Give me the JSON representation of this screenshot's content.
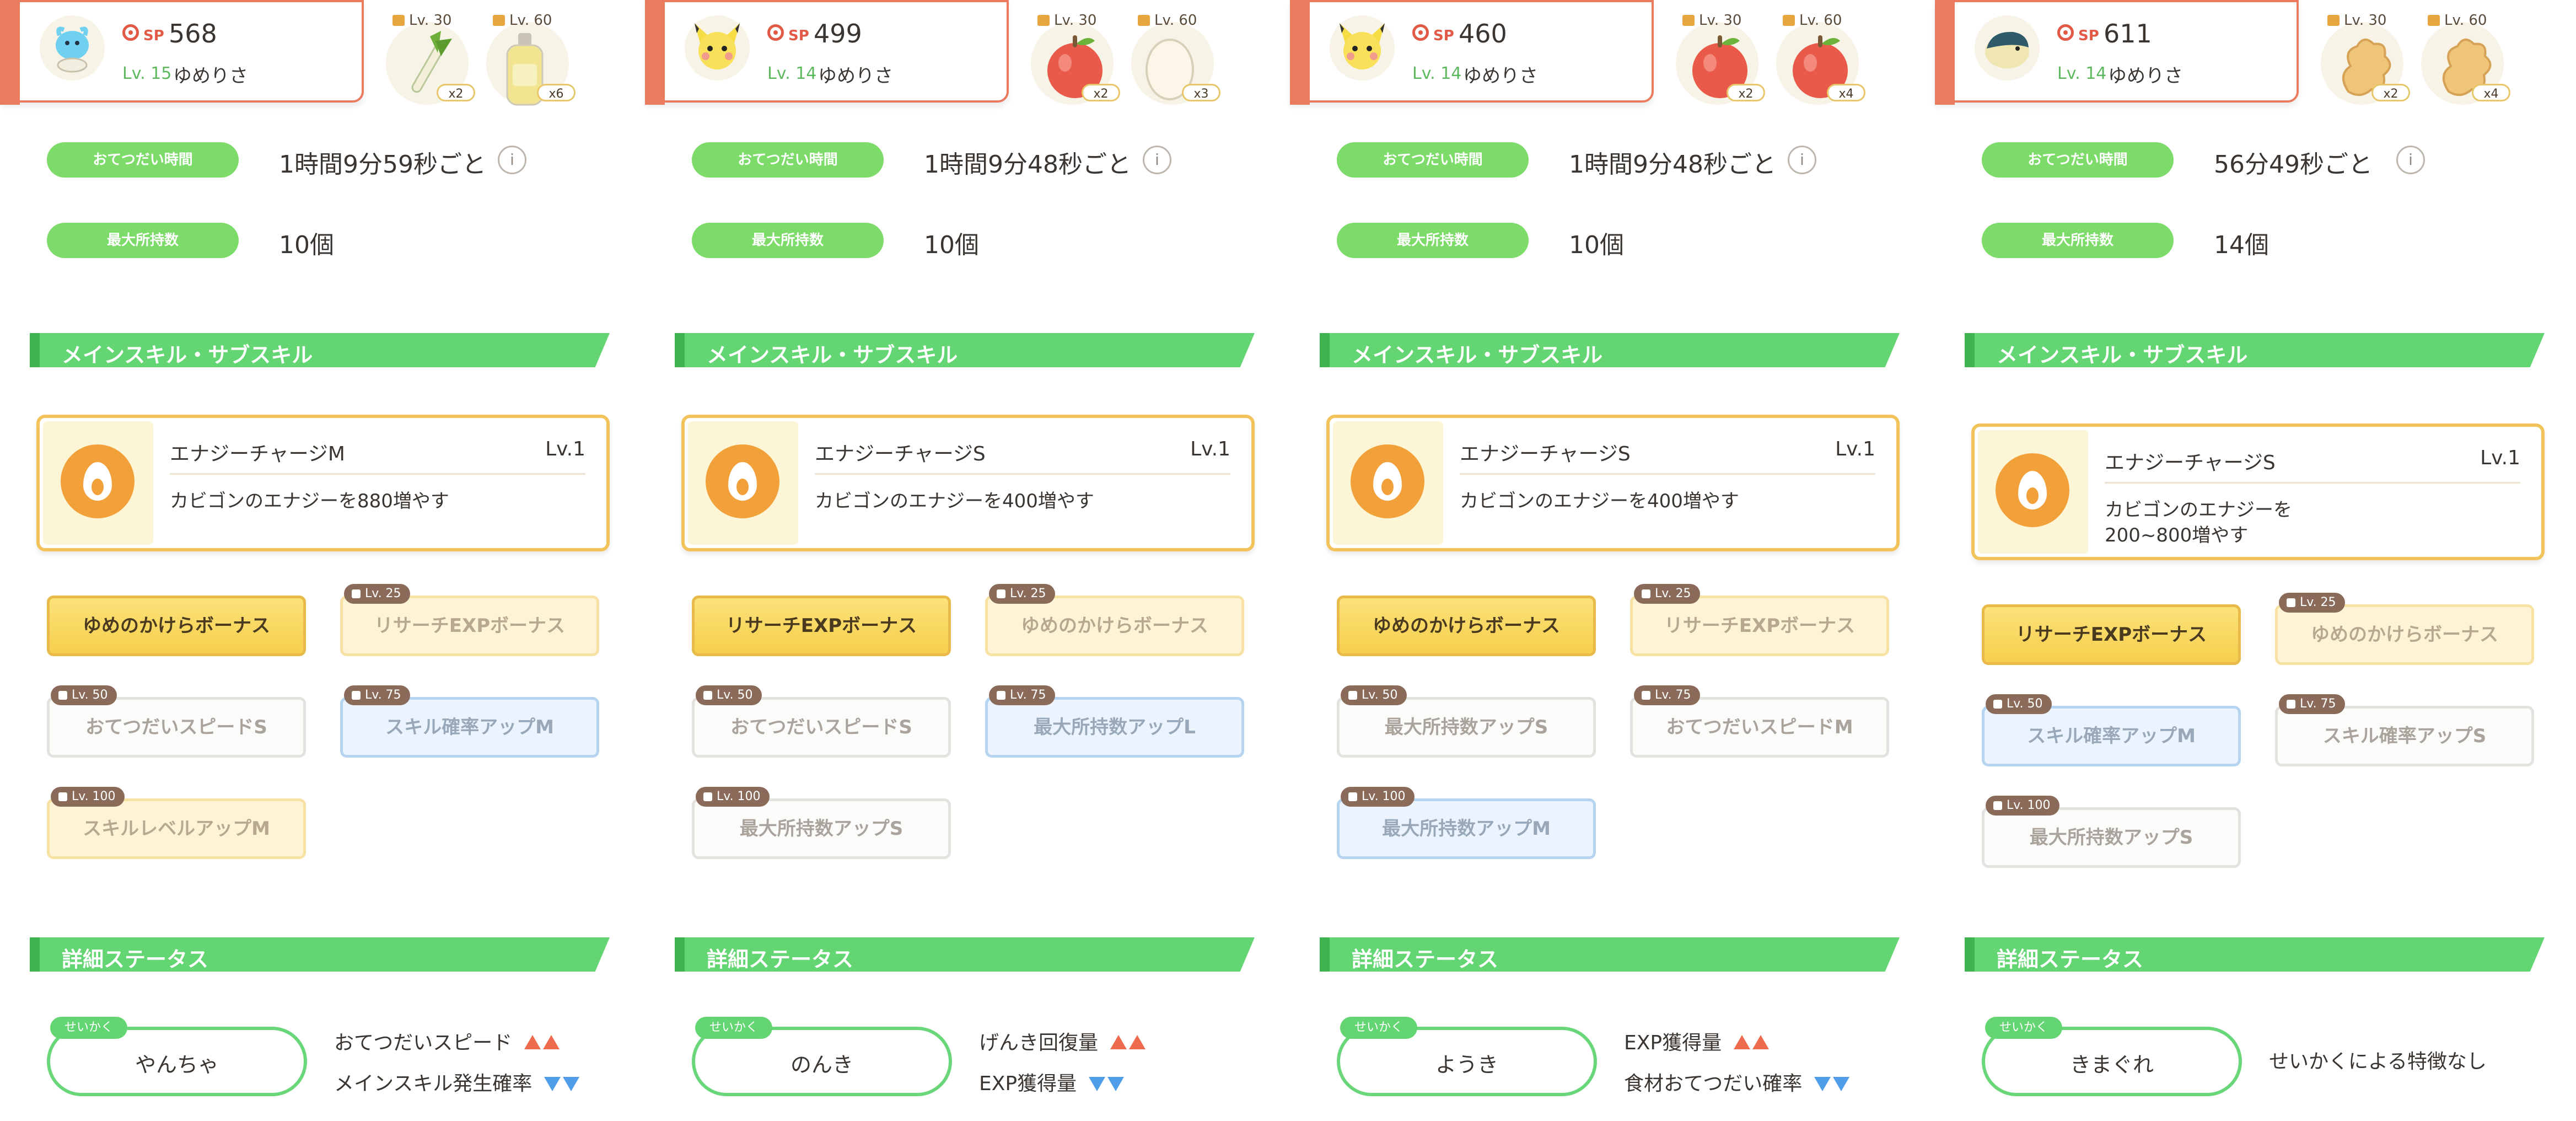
{
  "ui": {
    "sp_label": "SP",
    "work_label": "おてつだい時間",
    "cap_label": "最大所持数",
    "skill_header": "メインスキル・サブスキル",
    "detail_header": "詳細ステータス",
    "nature_tag": "せいかく"
  },
  "colors": {
    "accent_header": "#ea7b5f",
    "green": "#64d573",
    "pill_green": "#7ddb6a",
    "skill_border": "#f2c35a",
    "gold": "#f8d860",
    "up_arrow": "#ee6c4d",
    "down_arrow": "#4f9de8"
  },
  "cards": [
    {
      "sp": "568",
      "level": "Lv. 15",
      "nickname": "ゆめりさ",
      "pokemon_icon": "quagsire-like-icon",
      "ingredients": [
        {
          "level": "Lv. 30",
          "qty": "x2",
          "icon": "leek-icon"
        },
        {
          "level": "Lv. 60",
          "qty": "x6",
          "icon": "oil-bottle-icon"
        }
      ],
      "work_time": "1時間9分59秒ごと",
      "capacity": "10個",
      "main_skill": {
        "name": "エナジーチャージM",
        "level": "Lv.1",
        "desc": "カビゴンのエナジーを880増やす"
      },
      "sub_skills": [
        {
          "name": "ゆめのかけらボーナス",
          "unlock": ""
        },
        {
          "name": "リサーチEXPボーナス",
          "unlock": "Lv. 25"
        },
        {
          "name": "おてつだいスピードS",
          "unlock": "Lv. 50"
        },
        {
          "name": "スキル確率アップM",
          "unlock": "Lv. 75"
        },
        {
          "name": "スキルレベルアップM",
          "unlock": "Lv. 100"
        }
      ],
      "nature": "やんちゃ",
      "effects": [
        {
          "text": "おてつだいスピード",
          "dir": "up"
        },
        {
          "text": "メインスキル発生確率",
          "dir": "down"
        }
      ]
    },
    {
      "sp": "499",
      "level": "Lv. 14",
      "nickname": "ゆめりさ",
      "pokemon_icon": "pichu-icon",
      "ingredients": [
        {
          "level": "Lv. 30",
          "qty": "x2",
          "icon": "apple-icon"
        },
        {
          "level": "Lv. 60",
          "qty": "x3",
          "icon": "egg-icon"
        }
      ],
      "work_time": "1時間9分48秒ごと",
      "capacity": "10個",
      "main_skill": {
        "name": "エナジーチャージS",
        "level": "Lv.1",
        "desc": "カビゴンのエナジーを400増やす"
      },
      "sub_skills": [
        {
          "name": "リサーチEXPボーナス",
          "unlock": ""
        },
        {
          "name": "ゆめのかけらボーナス",
          "unlock": "Lv. 25"
        },
        {
          "name": "おてつだいスピードS",
          "unlock": "Lv. 50"
        },
        {
          "name": "最大所持数アップL",
          "unlock": "Lv. 75"
        },
        {
          "name": "最大所持数アップS",
          "unlock": "Lv. 100"
        }
      ],
      "nature": "のんき",
      "effects": [
        {
          "text": "げんき回復量",
          "dir": "up"
        },
        {
          "text": "EXP獲得量",
          "dir": "down"
        }
      ]
    },
    {
      "sp": "460",
      "level": "Lv. 14",
      "nickname": "ゆめりさ",
      "pokemon_icon": "pichu-icon",
      "ingredients": [
        {
          "level": "Lv. 30",
          "qty": "x2",
          "icon": "apple-icon"
        },
        {
          "level": "Lv. 60",
          "qty": "x4",
          "icon": "apple-icon"
        }
      ],
      "work_time": "1時間9分48秒ごと",
      "capacity": "10個",
      "main_skill": {
        "name": "エナジーチャージS",
        "level": "Lv.1",
        "desc": "カビゴンのエナジーを400増やす"
      },
      "sub_skills": [
        {
          "name": "ゆめのかけらボーナス",
          "unlock": ""
        },
        {
          "name": "リサーチEXPボーナス",
          "unlock": "Lv. 25"
        },
        {
          "name": "最大所持数アップS",
          "unlock": "Lv. 50"
        },
        {
          "name": "おてつだいスピードM",
          "unlock": "Lv. 75"
        },
        {
          "name": "最大所持数アップM",
          "unlock": "Lv. 100"
        }
      ],
      "nature": "ようき",
      "effects": [
        {
          "text": "EXP獲得量",
          "dir": "up"
        },
        {
          "text": "食材おてつだい確率",
          "dir": "down"
        }
      ]
    },
    {
      "sp": "611",
      "level": "Lv. 14",
      "nickname": "ゆめりさ",
      "pokemon_icon": "cyndaquil-icon",
      "ingredients": [
        {
          "level": "Lv. 30",
          "qty": "x2",
          "icon": "ginger-icon"
        },
        {
          "level": "Lv. 60",
          "qty": "x4",
          "icon": "ginger-icon"
        }
      ],
      "work_time": "56分49秒ごと",
      "capacity": "14個",
      "main_skill": {
        "name": "エナジーチャージS",
        "level": "Lv.1",
        "desc": "カビゴンのエナジーを200~800増やす"
      },
      "sub_skills": [
        {
          "name": "リサーチEXPボーナス",
          "unlock": ""
        },
        {
          "name": "ゆめのかけらボーナス",
          "unlock": "Lv. 25"
        },
        {
          "name": "スキル確率アップM",
          "unlock": "Lv. 50"
        },
        {
          "name": "スキル確率アップS",
          "unlock": "Lv. 75"
        },
        {
          "name": "最大所持数アップS",
          "unlock": "Lv. 100"
        }
      ],
      "nature": "きまぐれ",
      "effects": [
        {
          "text": "せいかくによる特徴なし",
          "dir": "none"
        }
      ]
    }
  ]
}
